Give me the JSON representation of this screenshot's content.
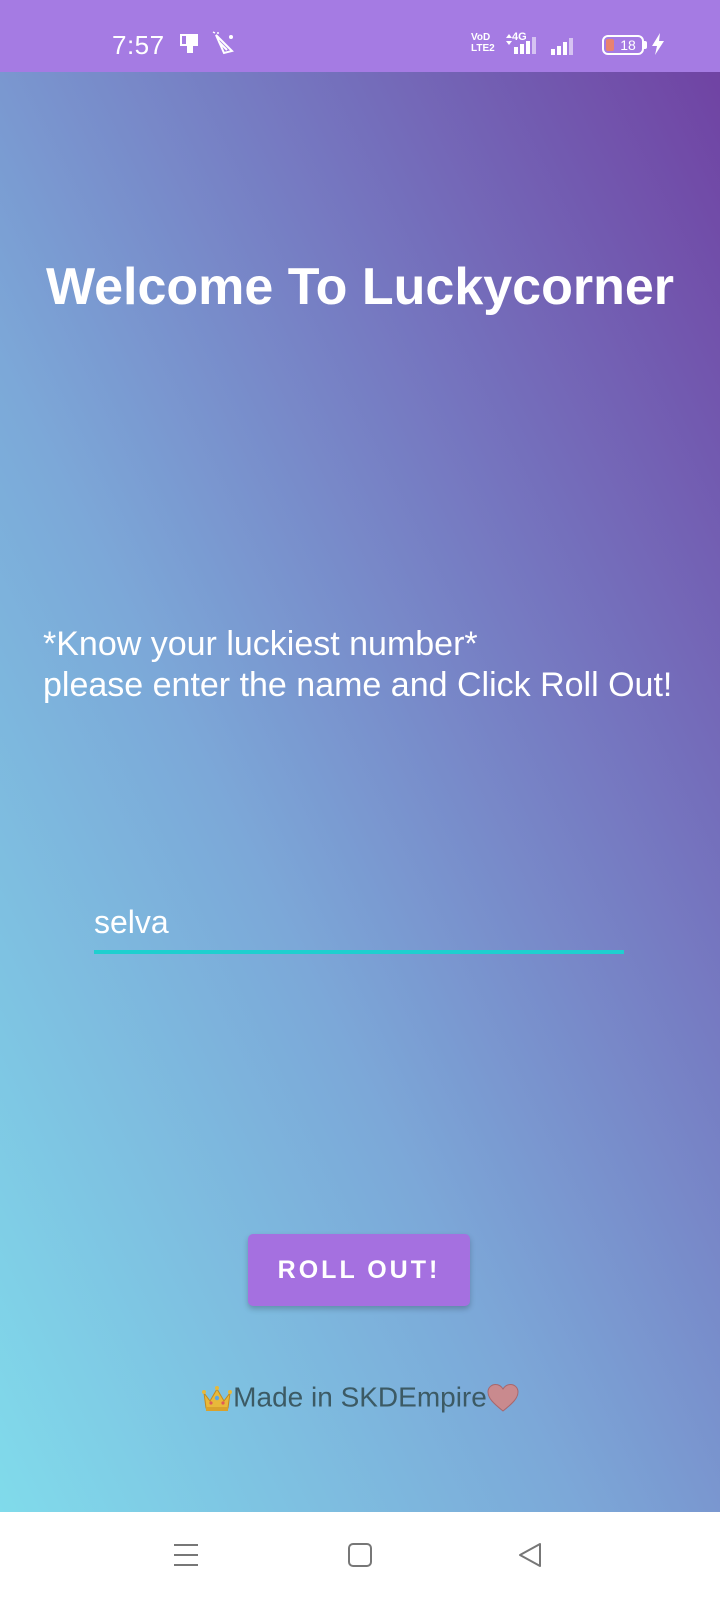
{
  "status_bar": {
    "time": "7:57",
    "network_label_top": "VoD",
    "network_label_bottom": "LTE2",
    "network_type": "4G",
    "battery_level": "18",
    "icons": [
      "screen-cast-icon",
      "notification-cone-icon",
      "volte-icon",
      "signal-4g-icon",
      "signal-icon",
      "battery-icon",
      "charging-bolt-icon"
    ],
    "background_color": "#a57be3"
  },
  "main": {
    "title": "Welcome To Luckycorner",
    "tagline_line1": "*Know your luckiest number*",
    "tagline_line2": "please enter the name and Click Roll Out!",
    "name_input_value": "selva",
    "roll_button_label": "ROLL OUT!",
    "footer_text": "Made in SKDEmpire",
    "footer_icons": [
      "crown-icon",
      "heart-icon"
    ],
    "colors": {
      "gradient_top_right": "#7043a3",
      "gradient_bottom_left": "#80dbeb",
      "button": "#a570e0",
      "input_underline": "#1fcfcf"
    }
  },
  "nav_bar": {
    "buttons": [
      "menu-icon",
      "home-icon",
      "back-icon"
    ]
  }
}
